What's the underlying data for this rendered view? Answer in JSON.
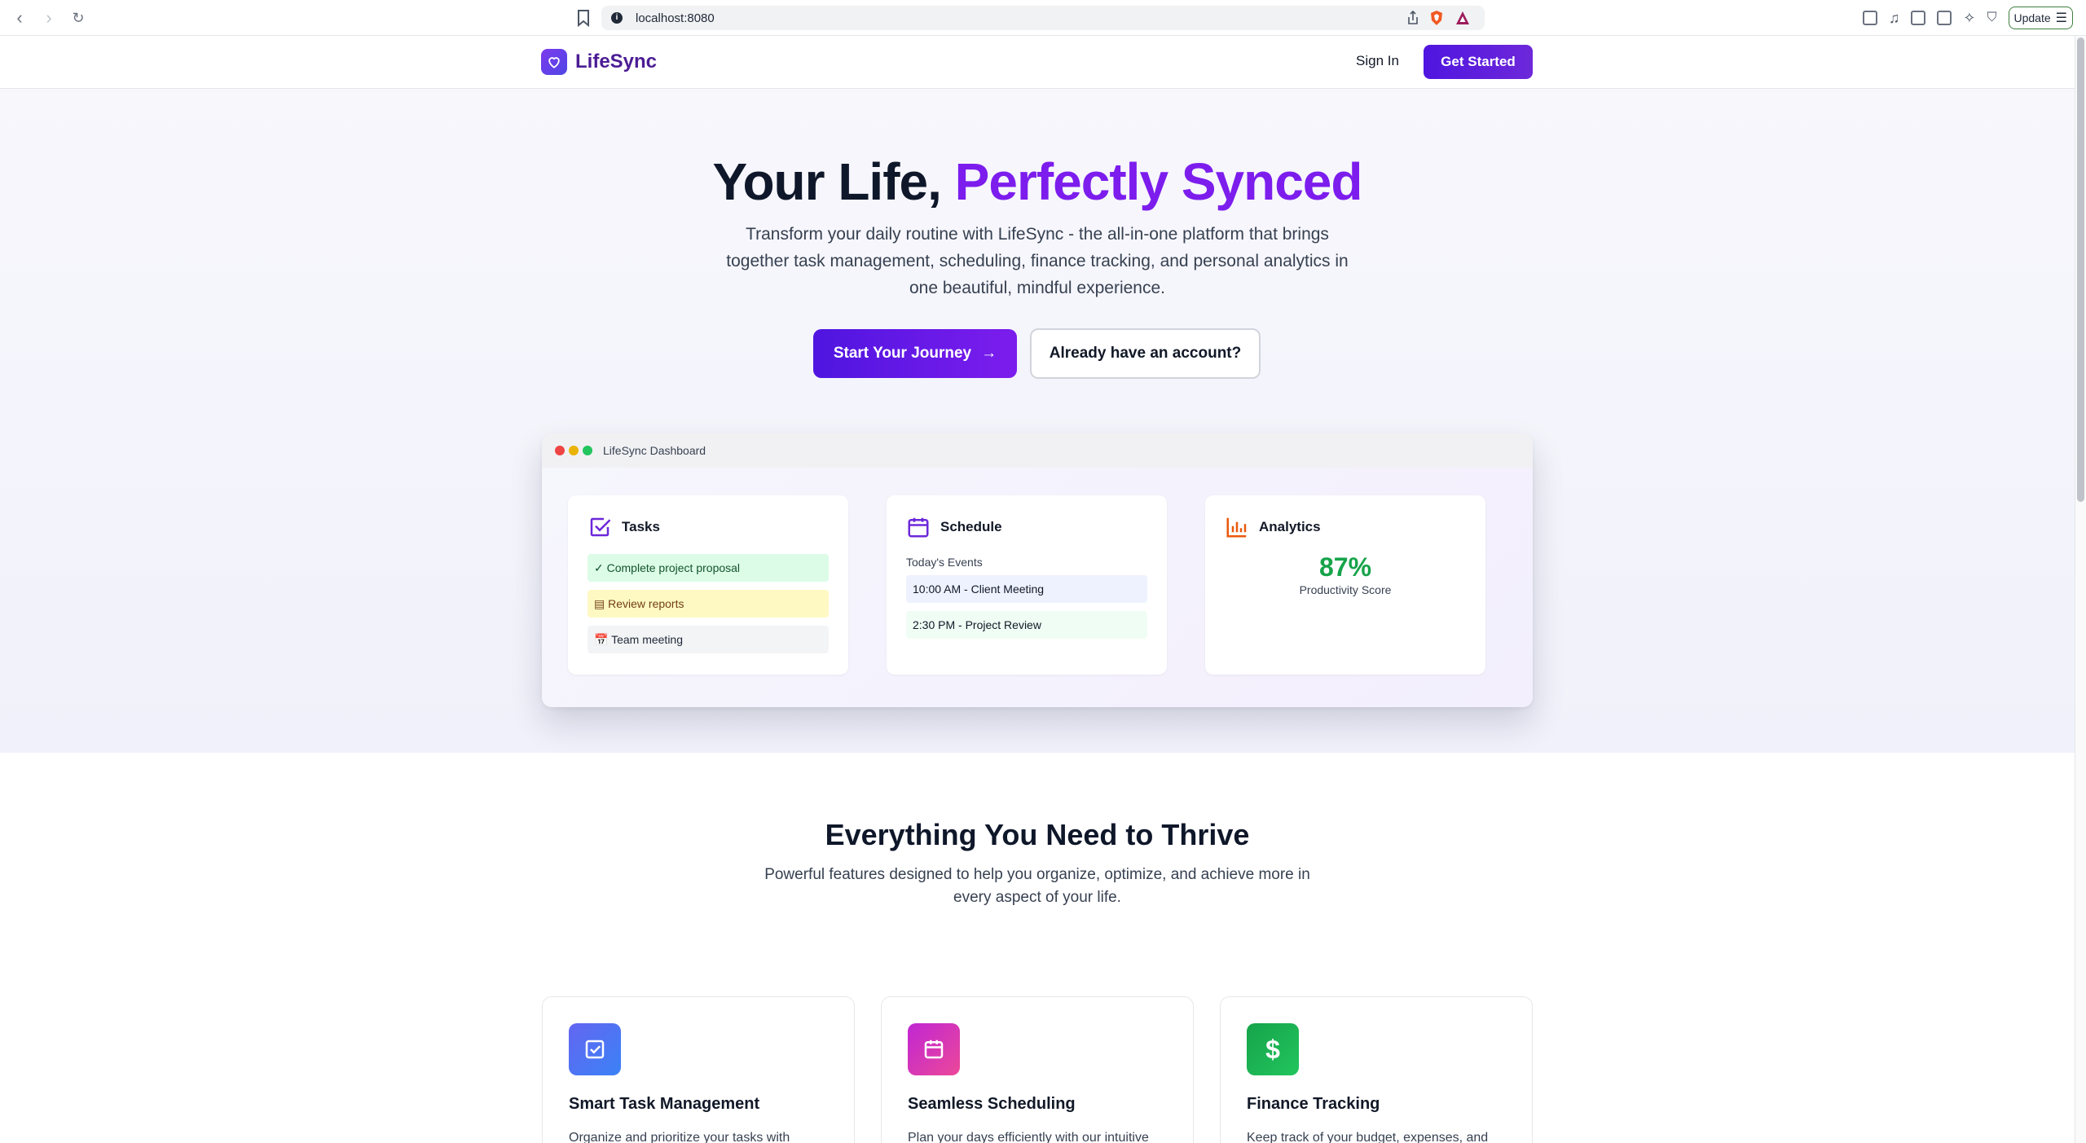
{
  "browser": {
    "url": "localhost:8080",
    "update_label": "Update"
  },
  "nav": {
    "brand": "LifeSync",
    "signin": "Sign In",
    "get_started": "Get Started"
  },
  "hero": {
    "title_part1": "Your Life, ",
    "title_accent": "Perfectly Synced",
    "subtitle": "Transform your daily routine with LifeSync - the all-in-one platform that brings together task management, scheduling, finance tracking, and personal analytics in one beautiful, mindful experience.",
    "primary_cta": "Start Your Journey",
    "secondary_cta": "Already have an account?"
  },
  "dashboard": {
    "window_title": "LifeSync Dashboard",
    "tasks": {
      "title": "Tasks",
      "items": [
        {
          "text": "✓ Complete project proposal",
          "bg": "#dcfce7",
          "color": "#14532d"
        },
        {
          "text": "▤ Review reports",
          "bg": "#fef9c3",
          "color": "#713f12"
        },
        {
          "text": "📅 Team meeting",
          "bg": "#f3f4f6",
          "color": "#1f2937"
        }
      ]
    },
    "schedule": {
      "title": "Schedule",
      "label": "Today's Events",
      "events": [
        {
          "text": "10:00 AM - Client Meeting",
          "bg": "#eef2ff"
        },
        {
          "text": "2:30 PM - Project Review",
          "bg": "#f0fdf4"
        }
      ]
    },
    "analytics": {
      "title": "Analytics",
      "score": "87%",
      "score_label": "Productivity Score"
    }
  },
  "features": {
    "heading": "Everything You Need to Thrive",
    "subheading": "Powerful features designed to help you organize, optimize, and achieve more in every aspect of your life.",
    "cards": [
      {
        "title": "Smart Task Management",
        "desc": "Organize and prioritize your tasks with intelligent scheduling and progress tracking.",
        "icon": "checkbox-icon"
      },
      {
        "title": "Seamless Scheduling",
        "desc": "Plan your days efficiently with our intuitive calendar and event management system.",
        "icon": "calendar-icon"
      },
      {
        "title": "Finance Tracking",
        "desc": "Keep track of your budget, expenses, and financial goals all in one place.",
        "icon": "dollar-icon"
      }
    ]
  },
  "colors": {
    "brand": "#5b21e6",
    "accent": "#7c1ded",
    "success": "#16a34a"
  }
}
